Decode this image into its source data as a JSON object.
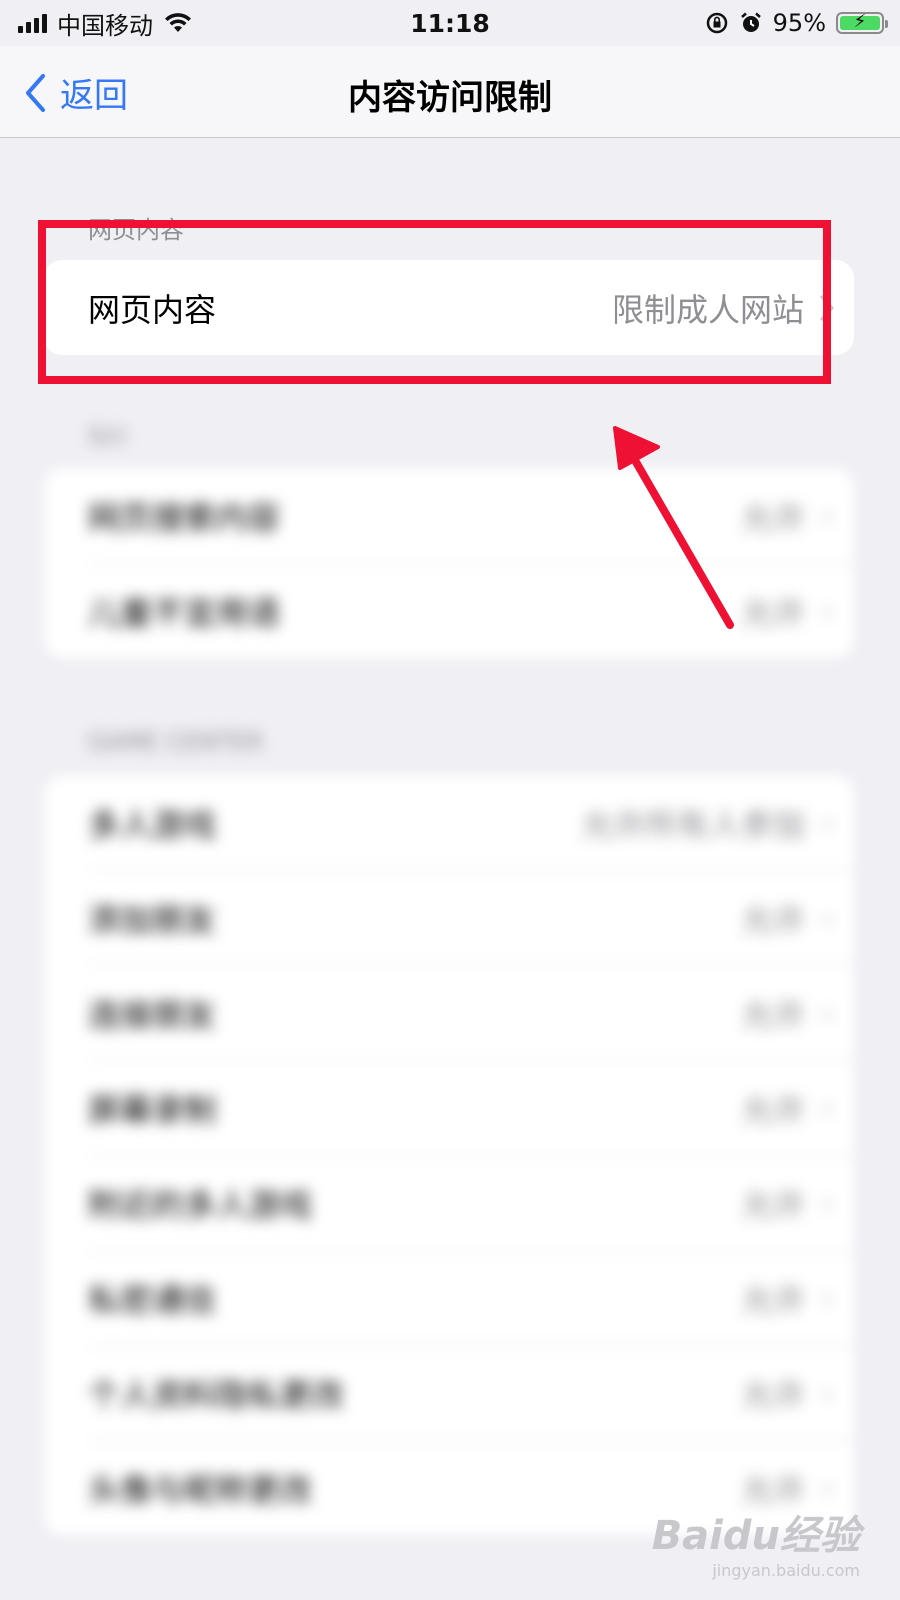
{
  "status_bar": {
    "carrier": "中国移动",
    "time": "11:18",
    "battery": "95%",
    "battery_level": 0.95,
    "battery_color": "#4cd964"
  },
  "nav": {
    "back_label": "返回",
    "title": "内容访问限制"
  },
  "web_section": {
    "header": "网页内容",
    "row_label": "网页内容",
    "row_value": "限制成人网站"
  },
  "siri_section": {
    "header": "Siri",
    "rows": [
      {
        "label": "网页搜索内容",
        "value": "允许"
      },
      {
        "label": "儿童不宜用语",
        "value": "允许"
      }
    ]
  },
  "game_center_section": {
    "header": "GAME CENTER",
    "rows": [
      {
        "label": "多人游戏",
        "value": "允许所有人参加"
      },
      {
        "label": "添加朋友",
        "value": "允许"
      },
      {
        "label": "连接朋友",
        "value": "允许"
      },
      {
        "label": "屏幕录制",
        "value": "允许"
      },
      {
        "label": "附近的多人游戏",
        "value": "允许"
      },
      {
        "label": "私密通信",
        "value": "允许"
      },
      {
        "label": "个人资料隐私更改",
        "value": "允许"
      },
      {
        "label": "头像与昵称更改",
        "value": "允许"
      }
    ]
  },
  "watermark": {
    "logo": "Baidu经验",
    "sub": "jingyan.baidu.com"
  },
  "accent_color": "#3478f6",
  "highlight_color": "#ee1133"
}
